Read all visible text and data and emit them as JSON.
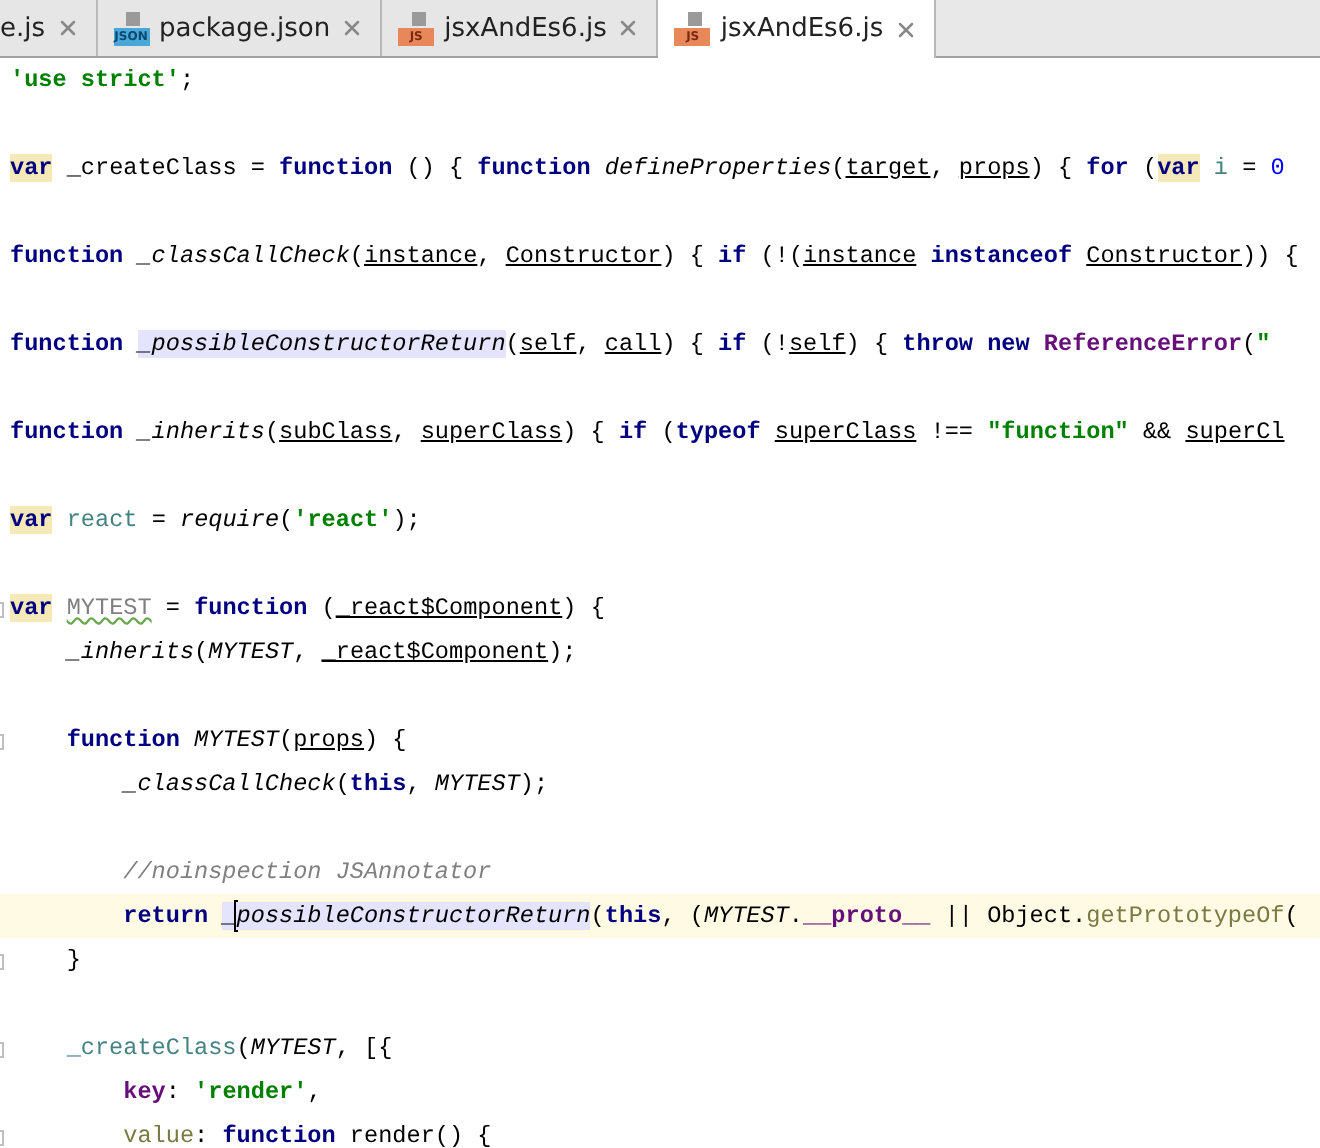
{
  "tabs": [
    {
      "label": "e.js",
      "selected": false
    },
    {
      "label": "package.json",
      "type": "JSON",
      "selected": false
    },
    {
      "label": "jsxAndEs6.js",
      "type": "JS",
      "selected": false
    },
    {
      "label": "jsxAndEs6.js",
      "type": "JS",
      "selected": true
    }
  ],
  "lines": [
    {
      "kind": "code",
      "tokens": [
        {
          "text": "'use strict'",
          "kind": "string"
        },
        {
          "text": ";",
          "kind": "plain"
        }
      ]
    },
    {
      "kind": "blank"
    },
    {
      "kind": "code",
      "tokens": [
        {
          "text": "var",
          "kind": "keyword",
          "usage_highlight": true
        },
        {
          "text": "_createClass =",
          "kind": "plain",
          "gap": true
        },
        {
          "text": "function",
          "kind": "keyword",
          "gap": true
        },
        {
          "text": "() {",
          "kind": "plain",
          "gap": true
        },
        {
          "text": "function",
          "kind": "keyword",
          "gap": true
        },
        {
          "text": "defineProperties",
          "kind": "fn",
          "gap": true
        },
        {
          "text": "(",
          "kind": "plain"
        },
        {
          "text": "target",
          "kind": "param"
        },
        {
          "text": ",",
          "kind": "plain"
        },
        {
          "text": "props",
          "kind": "param",
          "gap": true
        },
        {
          "text": ") {",
          "kind": "plain"
        },
        {
          "text": "for",
          "kind": "keyword",
          "gap": true
        },
        {
          "text": "(",
          "kind": "plain",
          "gap": true
        },
        {
          "text": "var",
          "kind": "keyword",
          "usage_highlight": true
        },
        {
          "text": "i",
          "kind": "global",
          "gap": true
        },
        {
          "text": "=",
          "kind": "plain",
          "gap": true
        },
        {
          "text": "0",
          "kind": "number",
          "gap": true
        }
      ]
    },
    {
      "kind": "blank"
    },
    {
      "kind": "code",
      "tokens": [
        {
          "text": "function",
          "kind": "keyword"
        },
        {
          "text": "_classCallCheck",
          "kind": "fn",
          "gap": true
        },
        {
          "text": "(",
          "kind": "plain"
        },
        {
          "text": "instance",
          "kind": "param"
        },
        {
          "text": ",",
          "kind": "plain"
        },
        {
          "text": "Constructor",
          "kind": "param",
          "gap": true
        },
        {
          "text": ") {",
          "kind": "plain"
        },
        {
          "text": "if",
          "kind": "keyword",
          "gap": true
        },
        {
          "text": "(!(",
          "kind": "plain",
          "gap": true
        },
        {
          "text": "instance",
          "kind": "param"
        },
        {
          "text": "instanceof",
          "kind": "keyword",
          "gap": true
        },
        {
          "text": "Constructor",
          "kind": "param",
          "gap": true
        },
        {
          "text": ")) {",
          "kind": "plain"
        }
      ]
    },
    {
      "kind": "blank"
    },
    {
      "kind": "code",
      "tokens": [
        {
          "text": "function",
          "kind": "keyword"
        },
        {
          "text": "_possibleConstructorReturn",
          "kind": "fn",
          "gap": true,
          "caret_highlight": true
        },
        {
          "text": "(",
          "kind": "plain"
        },
        {
          "text": "self",
          "kind": "param"
        },
        {
          "text": ",",
          "kind": "plain"
        },
        {
          "text": "call",
          "kind": "param",
          "gap": true
        },
        {
          "text": ") {",
          "kind": "plain"
        },
        {
          "text": "if",
          "kind": "keyword",
          "gap": true
        },
        {
          "text": "(!",
          "kind": "plain",
          "gap": true
        },
        {
          "text": "self",
          "kind": "param"
        },
        {
          "text": ") {",
          "kind": "plain"
        },
        {
          "text": "throw",
          "kind": "keyword",
          "gap": true
        },
        {
          "text": "new",
          "kind": "keyword",
          "gap": true
        },
        {
          "text": "ReferenceError",
          "kind": "class",
          "gap": true
        },
        {
          "text": "(",
          "kind": "plain"
        },
        {
          "text": "\"",
          "kind": "string"
        }
      ]
    },
    {
      "kind": "blank"
    },
    {
      "kind": "code",
      "tokens": [
        {
          "text": "function",
          "kind": "keyword"
        },
        {
          "text": "_inherits",
          "kind": "fn",
          "gap": true
        },
        {
          "text": "(",
          "kind": "plain"
        },
        {
          "text": "subClass",
          "kind": "param"
        },
        {
          "text": ",",
          "kind": "plain"
        },
        {
          "text": "superClass",
          "kind": "param",
          "gap": true
        },
        {
          "text": ") {",
          "kind": "plain"
        },
        {
          "text": "if",
          "kind": "keyword",
          "gap": true
        },
        {
          "text": "(",
          "kind": "plain",
          "gap": true
        },
        {
          "text": "typeof",
          "kind": "keyword"
        },
        {
          "text": "superClass",
          "kind": "param",
          "gap": true
        },
        {
          "text": "!==",
          "kind": "plain",
          "gap": true
        },
        {
          "text": "\"function\"",
          "kind": "string",
          "gap": true
        },
        {
          "text": "&&",
          "kind": "plain",
          "gap": true
        },
        {
          "text": "superCl",
          "kind": "param",
          "gap": true
        }
      ]
    },
    {
      "kind": "blank"
    },
    {
      "kind": "code",
      "tokens": [
        {
          "text": "var",
          "kind": "keyword",
          "usage_highlight": true
        },
        {
          "text": "react",
          "kind": "global",
          "gap": true
        },
        {
          "text": "=",
          "kind": "plain",
          "gap": true
        },
        {
          "text": "require",
          "kind": "fn",
          "gap": true
        },
        {
          "text": "(",
          "kind": "plain"
        },
        {
          "text": "'react'",
          "kind": "string"
        },
        {
          "text": ");",
          "kind": "plain"
        }
      ]
    },
    {
      "kind": "blank"
    },
    {
      "kind": "code",
      "fold": true,
      "tokens": [
        {
          "text": "var",
          "kind": "keyword",
          "usage_highlight": true
        },
        {
          "text": "MYTEST",
          "kind": "unused",
          "gap": true
        },
        {
          "text": "=",
          "kind": "plain",
          "gap": true
        },
        {
          "text": "function",
          "kind": "keyword",
          "gap": true
        },
        {
          "text": "(",
          "kind": "plain",
          "gap": true
        },
        {
          "text": "_react$Component",
          "kind": "param"
        },
        {
          "text": ") {",
          "kind": "plain"
        }
      ],
      "children": [
        {
          "kind": "code",
          "tokens": [
            {
              "text": "_inherits",
              "kind": "fn"
            },
            {
              "text": "(",
              "kind": "plain"
            },
            {
              "text": "MYTEST",
              "kind": "fn"
            },
            {
              "text": ",",
              "kind": "plain"
            },
            {
              "text": "_react$Component",
              "kind": "param",
              "gap": true
            },
            {
              "text": ");",
              "kind": "plain"
            }
          ]
        },
        {
          "kind": "blank"
        },
        {
          "kind": "code",
          "fold": true,
          "tokens": [
            {
              "text": "function",
              "kind": "keyword"
            },
            {
              "text": "MYTEST",
              "kind": "fn",
              "gap": true
            },
            {
              "text": "(",
              "kind": "plain"
            },
            {
              "text": "props",
              "kind": "param"
            },
            {
              "text": ") {",
              "kind": "plain"
            }
          ],
          "children": [
            {
              "kind": "code",
              "tokens": [
                {
                  "text": "_classCallCheck",
                  "kind": "fn"
                },
                {
                  "text": "(",
                  "kind": "plain"
                },
                {
                  "text": "this",
                  "kind": "keyword"
                },
                {
                  "text": ",",
                  "kind": "plain"
                },
                {
                  "text": "MYTEST",
                  "kind": "fn",
                  "gap": true
                },
                {
                  "text": ");",
                  "kind": "plain"
                }
              ]
            },
            {
              "kind": "blank"
            },
            {
              "kind": "code",
              "tokens": [
                {
                  "text": "//noinspection JSAnnotator",
                  "kind": "comment"
                }
              ]
            },
            {
              "kind": "code",
              "current": true,
              "tokens": [
                {
                  "text": "return",
                  "kind": "keyword"
                },
                {
                  "text": "_",
                  "kind": "fn",
                  "gap": true,
                  "caret_highlight": true
                },
                {
                  "kind": "caret"
                },
                {
                  "text": "possibleConstructorReturn",
                  "kind": "fn",
                  "caret_highlight": true
                },
                {
                  "text": "(",
                  "kind": "plain"
                },
                {
                  "text": "this",
                  "kind": "keyword"
                },
                {
                  "text": ", (",
                  "kind": "plain"
                },
                {
                  "text": "MYTEST",
                  "kind": "fn"
                },
                {
                  "text": ".",
                  "kind": "plain"
                },
                {
                  "text": "__proto__",
                  "kind": "prop"
                },
                {
                  "text": "||",
                  "kind": "plain",
                  "gap": true
                },
                {
                  "text": "Object",
                  "kind": "plain",
                  "gap": true
                },
                {
                  "text": ".",
                  "kind": "plain"
                },
                {
                  "text": "getPrototypeOf",
                  "kind": "method"
                },
                {
                  "text": "(",
                  "kind": "plain"
                }
              ]
            }
          ]
        },
        {
          "kind": "code",
          "fold": true,
          "tokens": [
            {
              "text": "}",
              "kind": "plain"
            }
          ]
        },
        {
          "kind": "blank"
        },
        {
          "kind": "code",
          "fold": true,
          "tokens": [
            {
              "text": "_createClass",
              "kind": "global"
            },
            {
              "text": "(",
              "kind": "plain"
            },
            {
              "text": "MYTEST",
              "kind": "fn"
            },
            {
              "text": ",",
              "kind": "plain"
            },
            {
              "text": "[{",
              "kind": "plain",
              "gap": true
            }
          ],
          "children": [
            {
              "kind": "code",
              "tokens": [
                {
                  "text": "key",
                  "kind": "prop"
                },
                {
                  "text": ":",
                  "kind": "plain"
                },
                {
                  "text": "'render'",
                  "kind": "string",
                  "gap": true
                },
                {
                  "text": ",",
                  "kind": "plain"
                }
              ]
            },
            {
              "kind": "code",
              "fold": true,
              "tokens": [
                {
                  "text": "value",
                  "kind": "method"
                },
                {
                  "text": ":",
                  "kind": "plain"
                },
                {
                  "text": "function",
                  "kind": "keyword",
                  "gap": true
                },
                {
                  "text": "render() {",
                  "kind": "plain",
                  "gap": true
                }
              ]
            }
          ]
        }
      ]
    }
  ]
}
